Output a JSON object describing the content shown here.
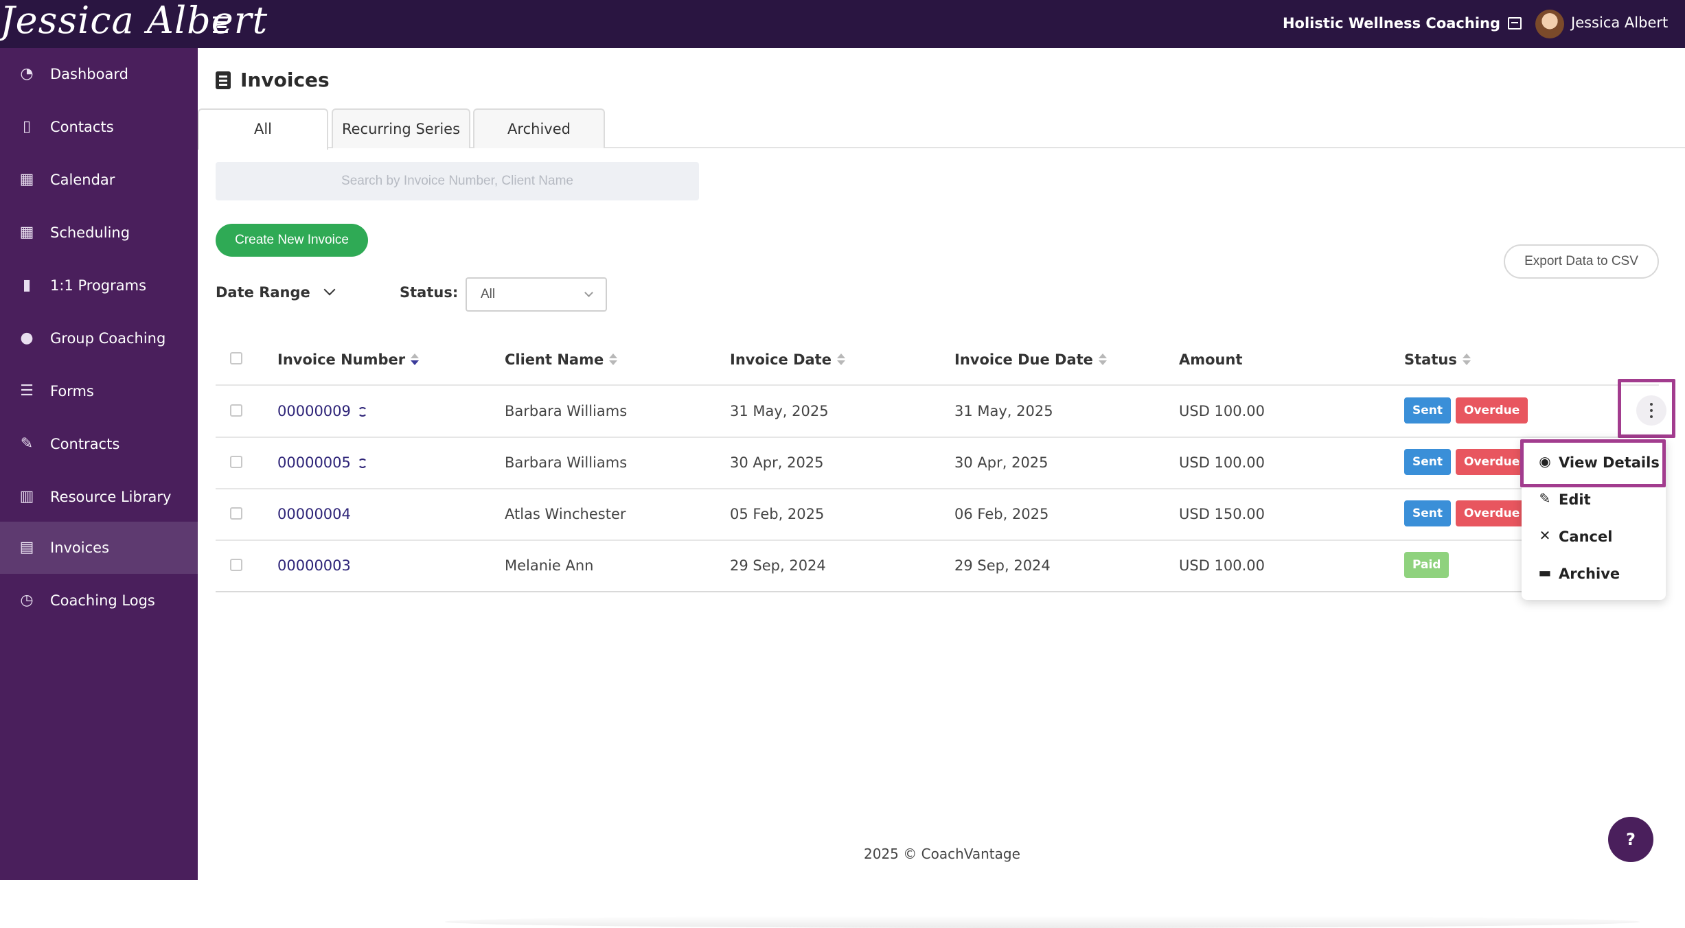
{
  "brand": {
    "logo_text": "Jessica Albert"
  },
  "header": {
    "org_name": "Holistic Wellness Coaching",
    "user_name": "Jessica Albert"
  },
  "sidebar": {
    "items": [
      {
        "label": "Dashboard",
        "icon": "dashboard-icon"
      },
      {
        "label": "Contacts",
        "icon": "contacts-icon"
      },
      {
        "label": "Calendar",
        "icon": "calendar-icon"
      },
      {
        "label": "Scheduling",
        "icon": "scheduling-icon"
      },
      {
        "label": "1:1 Programs",
        "icon": "book-icon"
      },
      {
        "label": "Group Coaching",
        "icon": "users-icon"
      },
      {
        "label": "Forms",
        "icon": "list-icon"
      },
      {
        "label": "Contracts",
        "icon": "signature-icon"
      },
      {
        "label": "Resource Library",
        "icon": "library-icon"
      },
      {
        "label": "Invoices",
        "icon": "invoice-icon",
        "active": true
      },
      {
        "label": "Coaching Logs",
        "icon": "clock-icon"
      }
    ]
  },
  "page": {
    "title": "Invoices"
  },
  "tabs": [
    {
      "label": "All"
    },
    {
      "label": "Recurring Series"
    },
    {
      "label": "Archived"
    }
  ],
  "search": {
    "placeholder": "Search by Invoice Number, Client Name",
    "value": ""
  },
  "actions": {
    "create_label": "Create New Invoice",
    "export_label": "Export Data to CSV"
  },
  "filters": {
    "date_range_label": "Date Range",
    "status_label": "Status:",
    "status_value": "All"
  },
  "table": {
    "headers": {
      "invoice_number": "Invoice Number",
      "client_name": "Client Name",
      "invoice_date": "Invoice Date",
      "due_date": "Invoice Due Date",
      "amount": "Amount",
      "status": "Status"
    },
    "rows": [
      {
        "invoice_number": "00000009",
        "recurring": true,
        "client": "Barbara Williams",
        "invoice_date": "31 May, 2025",
        "due_date": "31 May, 2025",
        "amount": "USD 100.00",
        "status": [
          "Sent",
          "Overdue"
        ]
      },
      {
        "invoice_number": "00000005",
        "recurring": true,
        "client": "Barbara Williams",
        "invoice_date": "30 Apr, 2025",
        "due_date": "30 Apr, 2025",
        "amount": "USD 100.00",
        "status": [
          "Sent",
          "Overdue"
        ]
      },
      {
        "invoice_number": "00000004",
        "recurring": false,
        "client": "Atlas Winchester",
        "invoice_date": "05 Feb, 2025",
        "due_date": "06 Feb, 2025",
        "amount": "USD 150.00",
        "status": [
          "Sent",
          "Overdue"
        ]
      },
      {
        "invoice_number": "00000003",
        "recurring": false,
        "client": "Melanie Ann",
        "invoice_date": "29 Sep, 2024",
        "due_date": "29 Sep, 2024",
        "amount": "USD 100.00",
        "status": [
          "Paid"
        ]
      }
    ]
  },
  "row_menu": {
    "items": [
      {
        "label": "View Details"
      },
      {
        "label": "Edit"
      },
      {
        "label": "Cancel"
      },
      {
        "label": "Archive"
      }
    ]
  },
  "footer": {
    "text": "2025 © CoachVantage"
  },
  "help": {
    "label": "?"
  },
  "colors": {
    "topbar": "#2a1541",
    "sidebar": "#4a1f5c",
    "accent_green": "#2faa55",
    "sent": "#3a8fd8",
    "overdue": "#e8565f",
    "paid": "#8fd27e",
    "highlight": "#a23c8e"
  }
}
